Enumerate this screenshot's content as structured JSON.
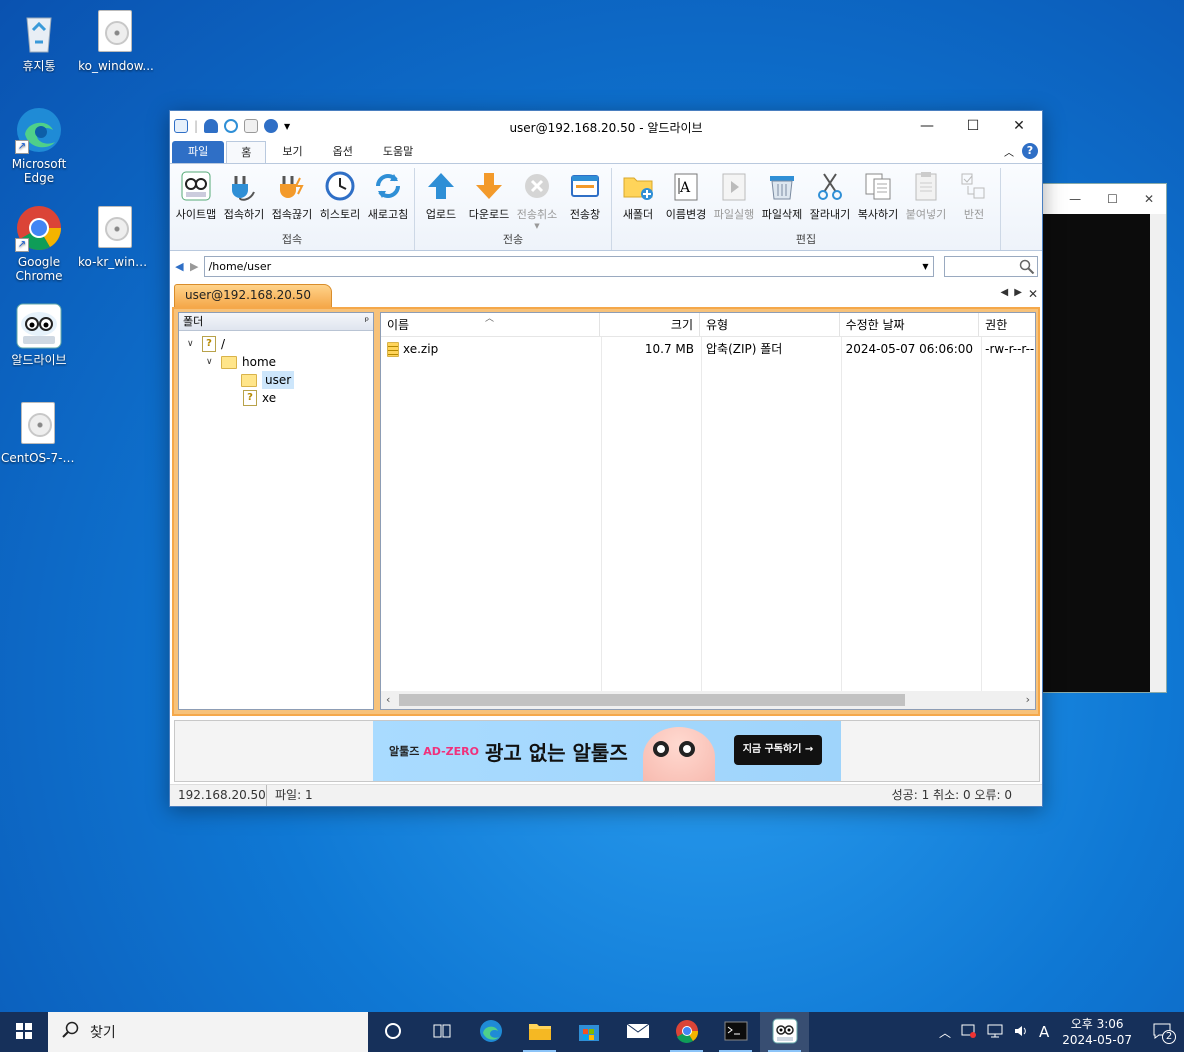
{
  "desktop": {
    "icons": [
      {
        "label": "휴지통"
      },
      {
        "label": "ko_window..."
      },
      {
        "label": "Microsoft Edge"
      },
      {
        "label": "Google Chrome"
      },
      {
        "label": "ko-kr_wind..."
      },
      {
        "label": "알드라이브"
      },
      {
        "label": "CentOS-7-x..."
      }
    ]
  },
  "window": {
    "title": "user@192.168.20.50 - 알드라이브",
    "controls": [
      "—",
      "☐",
      "✕"
    ]
  },
  "tabs": {
    "file": "파일",
    "home": "홈",
    "view": "보기",
    "options": "옵션",
    "help": "도움말"
  },
  "ribbon": {
    "connect": {
      "label": "접속",
      "buttons": [
        "사이트맵",
        "접속하기",
        "접속끊기",
        "히스토리",
        "새로고침"
      ]
    },
    "transfer": {
      "label": "전송",
      "buttons": [
        "업로드",
        "다운로드",
        "전송취소",
        "전송창"
      ]
    },
    "edit": {
      "label": "편집",
      "buttons": [
        "새폴더",
        "이름변경",
        "파일실행",
        "파일삭제",
        "잘라내기",
        "복사하기",
        "붙여넣기",
        "반전"
      ]
    }
  },
  "address": {
    "path": "/home/user",
    "search": ""
  },
  "session": {
    "tab": "user@192.168.20.50"
  },
  "tree": {
    "header": "폴더",
    "nodes": [
      "/",
      "home",
      "user",
      "xe"
    ]
  },
  "list": {
    "columns": [
      "이름",
      "크기",
      "유형",
      "수정한 날짜",
      "권한"
    ],
    "rows": [
      {
        "name": "xe.zip",
        "size": "10.7 MB",
        "type": "압축(ZIP) 폴더",
        "date": "2024-05-07 06:06:00",
        "perm": "-rw-r--r--"
      }
    ]
  },
  "ad": {
    "brand_prefix": "알툴즈",
    "brand_suffix": "AD-ZERO",
    "headline": "광고 없는 알툴즈",
    "cta": "지금 구독하기 →"
  },
  "status": {
    "host": "192.168.20.50",
    "files": "파일: 1",
    "summary": "성공: 1 취소: 0 오류: 0"
  },
  "taskbar": {
    "search": "찾기",
    "clock_time": "오후 3:06",
    "clock_date": "2024-05-07",
    "ime": "A",
    "notif": "2"
  }
}
